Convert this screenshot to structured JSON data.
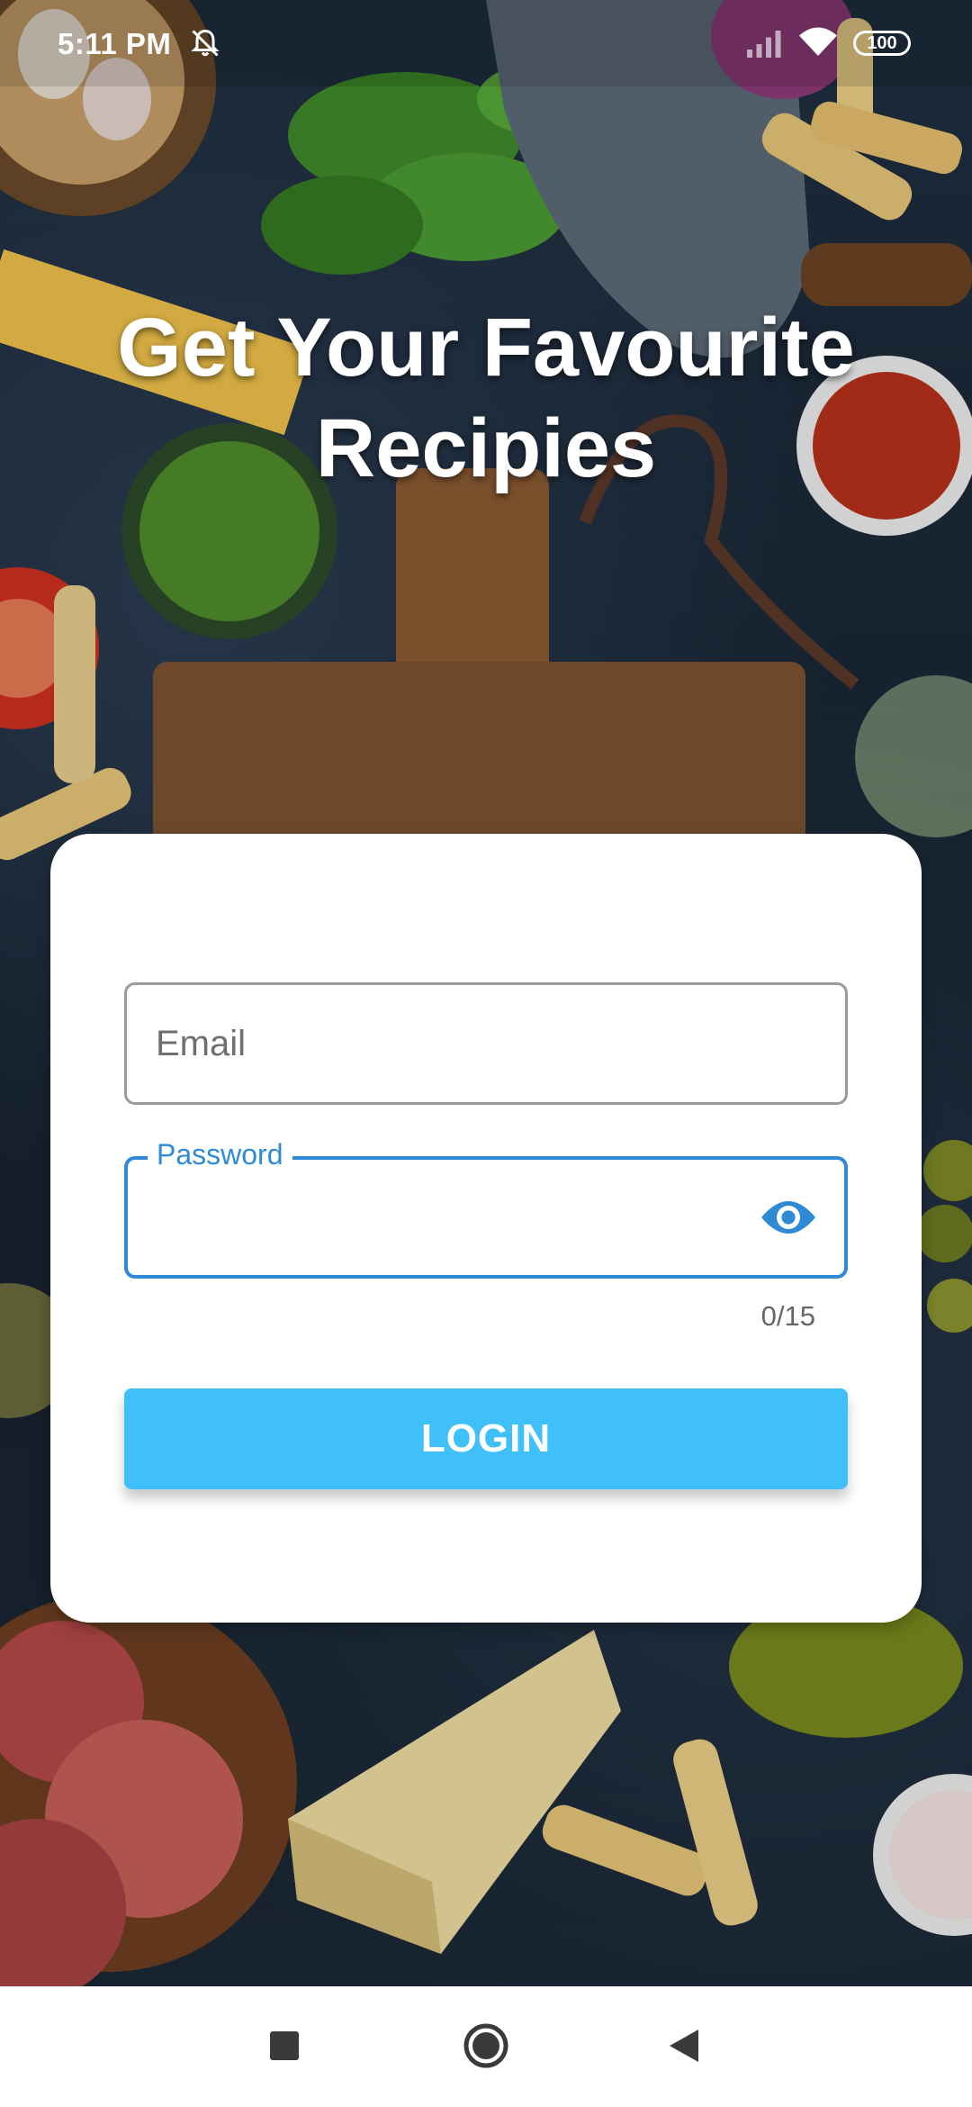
{
  "status_bar": {
    "time": "5:11 PM",
    "battery": "100",
    "icons": [
      "mute-icon",
      "signal-icon",
      "wifi-icon",
      "battery-icon"
    ]
  },
  "headline": "Get Your Favourite Recipies",
  "login_form": {
    "email_placeholder": "Email",
    "email_value": "",
    "password_label": "Password",
    "password_value": "",
    "password_counter": "0/15",
    "visibility_icon": "eye-icon",
    "login_label": "LOGIN"
  },
  "colors": {
    "accent": "#2f8ad6",
    "button": "#40c0fb",
    "card": "#ffffff"
  },
  "nav_bar": {
    "icons": [
      "recents-icon",
      "home-icon",
      "back-icon"
    ]
  }
}
